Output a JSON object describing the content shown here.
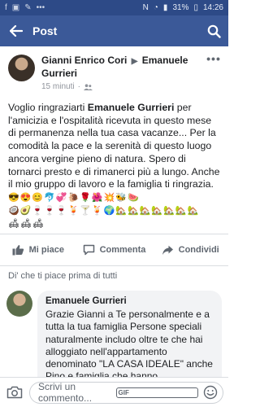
{
  "statusbar": {
    "battery": "31%",
    "time": "14:26"
  },
  "appbar": {
    "title": "Post"
  },
  "post": {
    "author": "Gianni Enrico Cori",
    "target": "Emanuele Gurrieri",
    "time": "15 minuti",
    "text_pre": "Voglio ringraziarti ",
    "text_bold": "Emanuele Gurrieri",
    "text_post": " per l'amicizia e l'ospitalità ricevuta in questo mese di permanenza nella tua casa vacanze... Per la comodità la pace e la serenità di questo luogo ancora vergine pieno di natura. Spero di tornarci presto e di rimanerci più a lungo. Anche il mio gruppo di lavoro e la famiglia ti ringrazia.",
    "emoji_1": "😎😍😊🐬💞🐌🌹🌺💥🐝🍉",
    "emoji_2": "🥥🥑🍷🍷🍷🍹🍸🍹🌍🏡🏡🏡🏡🏡🏡🏡",
    "emoji_3": "🛋🛋🛋"
  },
  "actions": {
    "like": "Mi piace",
    "comment": "Commenta",
    "share": "Condividi"
  },
  "first_like": "Di' che ti piace prima di tutti",
  "comment": {
    "author": "Emanuele Gurrieri",
    "text": "Grazie Gianni a Te personalmente e a tutta la tua famiglia Persone speciali naturalmente includo oltre te che hai alloggiato nell'appartamento denominato \"LA CASA IDEALE\" anche Pino e famiglia che hanno"
  },
  "composer": {
    "placeholder": "Scrivi un commento...",
    "gif": "GIF"
  },
  "colors": {
    "brand": "#3b5998",
    "statusbar": "#2d4a87"
  }
}
